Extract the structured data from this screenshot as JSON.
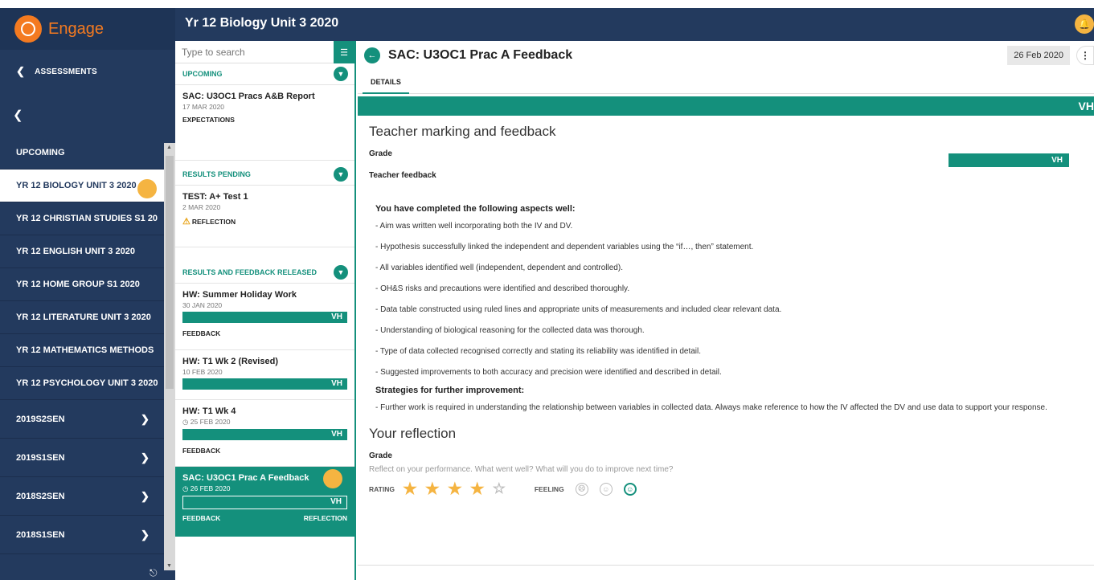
{
  "app": {
    "brand": "Engage"
  },
  "sidebar": {
    "back_label": "ASSESSMENTS",
    "items": [
      {
        "label": "UPCOMING"
      },
      {
        "label": "YR 12 BIOLOGY UNIT 3 2020",
        "active": true
      },
      {
        "label": "YR 12 CHRISTIAN STUDIES S1 20"
      },
      {
        "label": "YR 12 ENGLISH UNIT 3 2020"
      },
      {
        "label": "YR 12 HOME GROUP S1 2020"
      },
      {
        "label": "YR 12 LITERATURE UNIT 3 2020"
      },
      {
        "label": "YR 12 MATHEMATICS METHODS"
      },
      {
        "label": "YR 12 PSYCHOLOGY UNIT 3 2020"
      },
      {
        "label": "2019S2SEN"
      },
      {
        "label": "2019S1SEN"
      },
      {
        "label": "2018S2SEN"
      },
      {
        "label": "2018S1SEN"
      }
    ]
  },
  "header": {
    "title": "Yr 12 Biology Unit 3 2020"
  },
  "list": {
    "search_placeholder": "Type to search",
    "sections": [
      {
        "label": "UPCOMING"
      },
      {
        "label": "RESULTS PENDING"
      },
      {
        "label": "RESULTS AND FEEDBACK RELEASED"
      }
    ],
    "tasks": [
      {
        "title": "SAC: U3OC1 Pracs A&B Report",
        "date": "17 MAR 2020",
        "tag": "EXPECTATIONS"
      },
      {
        "title": "TEST: A+ Test 1",
        "date": "2 MAR 2020",
        "tag": "REFLECTION"
      },
      {
        "title": "HW: Summer Holiday Work",
        "date": "30 JAN 2020",
        "grade": "VH",
        "tag": "FEEDBACK"
      },
      {
        "title": "HW: T1 Wk 2 (Revised)",
        "date": "10 FEB 2020",
        "grade": "VH"
      },
      {
        "title": "HW: T1 Wk 4",
        "date": "25 FEB 2020",
        "grade": "VH",
        "tag": "FEEDBACK"
      },
      {
        "title": "SAC: U3OC1 Prac A Feedback",
        "date": "26 FEB 2020",
        "grade": "VH",
        "tag": "FEEDBACK",
        "tag2": "REFLECTION"
      }
    ]
  },
  "main": {
    "title": "SAC: U3OC1 Prac A Feedback",
    "date": "26 Feb 2020",
    "tab": "DETAILS",
    "strip_grade": "VH",
    "marking_heading": "Teacher marking and feedback",
    "grade_label": "Grade",
    "grade_value": "VH",
    "feedback_label": "Teacher feedback",
    "feedback_heading": "You have completed the following aspects well:",
    "feedback_items": [
      "- Aim was written well incorporating both the IV and DV.",
      "- Hypothesis successfully linked the independent and dependent variables using the “if…, then” statement.",
      "- All variables identified well (independent, dependent and controlled).",
      "- OH&S risks and precautions were identified and described thoroughly.",
      "- Data table constructed using ruled lines and appropriate units of measurements and included clear relevant data.",
      "- Understanding of biological reasoning for the collected data was thorough.",
      "- Type of data collected recognised correctly and stating its reliability was identified in detail.",
      "- Suggested improvements to both accuracy and precision were identified and described in detail."
    ],
    "strategies_heading": "Strategies for further improvement:",
    "strategies_items": [
      "- Further work is required in understanding the relationship between variables in collected data. Always make reference to how the IV affected the DV and use data to support your response."
    ],
    "reflection_heading": "Your reflection",
    "reflection_grade_label": "Grade",
    "reflection_prompt": "Reflect on your performance. What went well? What will you do to improve next time?",
    "rating_label": "RATING",
    "rating_value": 4,
    "rating_max": 5,
    "feeling_label": "FEELING",
    "feeling_selected": "happy"
  },
  "colors": {
    "navy": "#233a5e",
    "teal": "#14907c",
    "accent": "#f5b441",
    "brand": "#f47a20"
  }
}
